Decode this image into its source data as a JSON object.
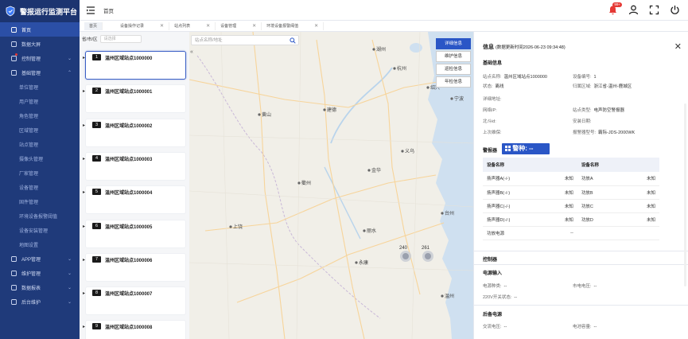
{
  "app": {
    "title": "警报运行监测平台"
  },
  "sidebar": {
    "items": [
      {
        "label": "首页",
        "active": true,
        "type": "top"
      },
      {
        "label": "数据大屏",
        "type": "top"
      },
      {
        "label": "控制管理",
        "type": "top",
        "expandable": true,
        "dot": true
      },
      {
        "label": "基础管理",
        "type": "top",
        "expandable": true,
        "expanded": true
      },
      {
        "label": "单位管理",
        "type": "sub"
      },
      {
        "label": "用户管理",
        "type": "sub"
      },
      {
        "label": "角色管理",
        "type": "sub"
      },
      {
        "label": "区域管理",
        "type": "sub"
      },
      {
        "label": "站点管理",
        "type": "sub"
      },
      {
        "label": "摄像头管理",
        "type": "sub"
      },
      {
        "label": "厂家管理",
        "type": "sub"
      },
      {
        "label": "设备管理",
        "type": "sub"
      },
      {
        "label": "固件管理",
        "type": "sub"
      },
      {
        "label": "环境设备报警阈值",
        "type": "sub"
      },
      {
        "label": "设备安装管理",
        "type": "sub"
      },
      {
        "label": "地图设置",
        "type": "sub"
      },
      {
        "label": "APP管理",
        "type": "top",
        "expandable": true
      },
      {
        "label": "维护管理",
        "type": "top",
        "expandable": true
      },
      {
        "label": "数据报表",
        "type": "top",
        "expandable": true
      },
      {
        "label": "后台维护",
        "type": "top",
        "expandable": true
      }
    ]
  },
  "header": {
    "breadcrumb": "首页",
    "notif_count": "99+"
  },
  "tabs": [
    {
      "label": "首页",
      "closable": false
    },
    {
      "label": "设备操作记录",
      "closable": true
    },
    {
      "label": "站点列表",
      "closable": true
    },
    {
      "label": "设备管理",
      "closable": true
    },
    {
      "label": "环境设备报警阈值",
      "closable": true
    }
  ],
  "list": {
    "filter_label": "省/市/区",
    "filter_placeholder": "请选择",
    "sites": [
      {
        "num": "1",
        "name": "温州区域站点1000000"
      },
      {
        "num": "2",
        "name": "温州区域站点1000001"
      },
      {
        "num": "3",
        "name": "温州区域站点1000002"
      },
      {
        "num": "4",
        "name": "温州区域站点1000003"
      },
      {
        "num": "5",
        "name": "温州区域站点1000004"
      },
      {
        "num": "6",
        "name": "温州区域站点1000005"
      },
      {
        "num": "7",
        "name": "温州区域站点1000006"
      },
      {
        "num": "8",
        "name": "温州区域站点1000007"
      },
      {
        "num": "9",
        "name": "温州区域站点1000008"
      }
    ]
  },
  "map": {
    "search_placeholder": "站点名称/地址",
    "buttons": [
      "详细信息",
      "维护信息",
      "巡检信息",
      "年检信息"
    ],
    "cities": [
      "杭州",
      "湖州",
      "绍兴",
      "宁波",
      "黄山",
      "金华",
      "衢州",
      "丽水",
      "温州",
      "上饶",
      "台州",
      "建德",
      "义乌",
      "永康"
    ],
    "clusters": [
      "240",
      "261"
    ]
  },
  "info": {
    "title": "信息",
    "updated": "(数据更新时间2026-06-23 09:34:48)",
    "basic_title": "基础信息",
    "fields": [
      {
        "k": "站点名称:",
        "v": "温州区域站点1000000"
      },
      {
        "k": "设备编号:",
        "v": "1"
      },
      {
        "k": "状态:",
        "v": "离线"
      },
      {
        "k": "归属区域:",
        "v": "浙江省-温州-鹿城区"
      },
      {
        "k": "详细地址:",
        "v": ""
      },
      {
        "k": "网络IP:",
        "v": ""
      },
      {
        "k": "站点类型:",
        "v": "电声防空警报器"
      },
      {
        "k": "北斗id:",
        "v": ""
      },
      {
        "k": "安装日期:",
        "v": ""
      },
      {
        "k": "上次维保:",
        "v": ""
      },
      {
        "k": "报警器型号:",
        "v": "霸际-JDS-2000WK"
      }
    ],
    "alarm_title": "警报器",
    "alarm_type": "警种: --",
    "dev_headers": [
      "设备名称",
      "设备名称"
    ],
    "dev_rows": [
      [
        "扬声器A(-/-)",
        "未知",
        "功放A",
        "未知"
      ],
      [
        "扬声器B(-/-)",
        "未知",
        "功放B",
        "未知"
      ],
      [
        "扬声器C(-/-)",
        "未知",
        "功放C",
        "未知"
      ],
      [
        "扬声器D(-/-)",
        "未知",
        "功放D",
        "未知"
      ],
      [
        "功放电源",
        "--",
        "",
        ""
      ]
    ],
    "control_title": "控制器",
    "power_title": "电源输入",
    "power_fields": [
      {
        "k": "电源种类:",
        "v": "--"
      },
      {
        "k": "市电电压:",
        "v": "--"
      },
      {
        "k": "220V开关状态:",
        "v": "--"
      }
    ],
    "backup_title": "后备电源",
    "backup_fields": [
      {
        "k": "交流电压:",
        "v": "--"
      },
      {
        "k": "电池容量:",
        "v": "--"
      }
    ]
  },
  "colors": {
    "sidebar": "#1f3a7a",
    "accent": "#2a56c6",
    "alert": "#e53935"
  }
}
